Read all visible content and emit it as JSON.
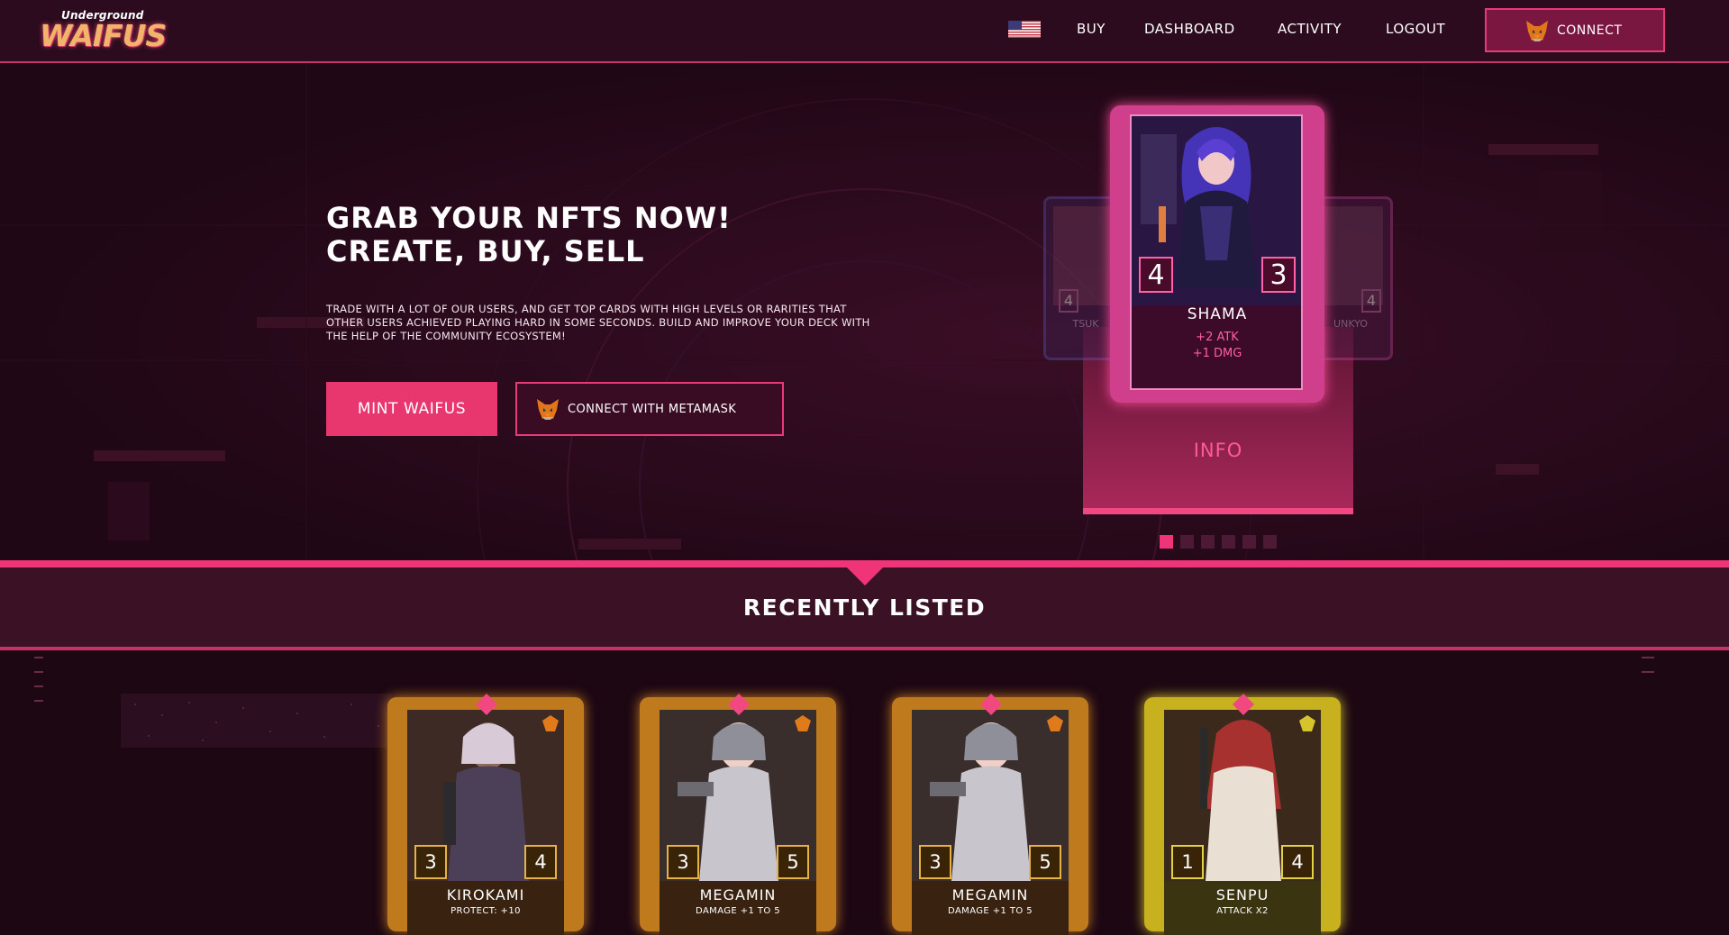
{
  "header": {
    "logo_top": "Underground",
    "logo_main": "WAIFUS",
    "nav": [
      {
        "label": "BUY"
      },
      {
        "label": "DASHBOARD"
      },
      {
        "label": "ACTIVITY"
      },
      {
        "label": "LOGOUT"
      }
    ],
    "connect_label": "CONNECT"
  },
  "hero": {
    "title_line1": "GRAB YOUR NFTS NOW!",
    "title_line2": "CREATE, BUY, SELL",
    "description": "Trade with a lot of our users, and get top cards with high levels or rarities that other users achieved playing hard in some seconds. Build and improve your deck with the help of the community ecosystem!",
    "mint_button": "MINT WAIFUS",
    "metamask_button": "CONNECT WITH METAMASK",
    "carousel": {
      "main_card": {
        "name": "SHAMA",
        "left_stat": "4",
        "right_stat": "3",
        "effect_line1": "+2 ATK",
        "effect_line2": "+1 DMG"
      },
      "left_card": {
        "name": "TSUK",
        "stat": "4"
      },
      "right_card": {
        "name": "UNKYO",
        "stat": "4"
      },
      "info_label": "INFO",
      "dots_count": 6,
      "active_dot": 0
    }
  },
  "recently_listed": {
    "title": "RECENTLY LISTED",
    "cards": [
      {
        "name": "KIROKAMI",
        "left_stat": "3",
        "right_stat": "4",
        "desc": "PROTECT: +10",
        "frame": "orange"
      },
      {
        "name": "MEGAMIN",
        "left_stat": "3",
        "right_stat": "5",
        "desc": "DAMAGE +1 TO 5",
        "frame": "orange"
      },
      {
        "name": "MEGAMIN",
        "left_stat": "3",
        "right_stat": "5",
        "desc": "DAMAGE +1 TO 5",
        "frame": "orange"
      },
      {
        "name": "SENPU",
        "left_stat": "1",
        "right_stat": "4",
        "desc": "ATTACK X2",
        "frame": "yellow"
      }
    ]
  },
  "colors": {
    "accent": "#ef3577",
    "background": "#1c0713",
    "header_bg": "#2c0b1e",
    "gold_frame": "#c07a1e",
    "yellow_frame": "#c7b11f"
  },
  "icons": [
    "us-flag-icon",
    "metamask-fox-icon",
    "rarity-gem-icon",
    "faction-badge-icon"
  ]
}
